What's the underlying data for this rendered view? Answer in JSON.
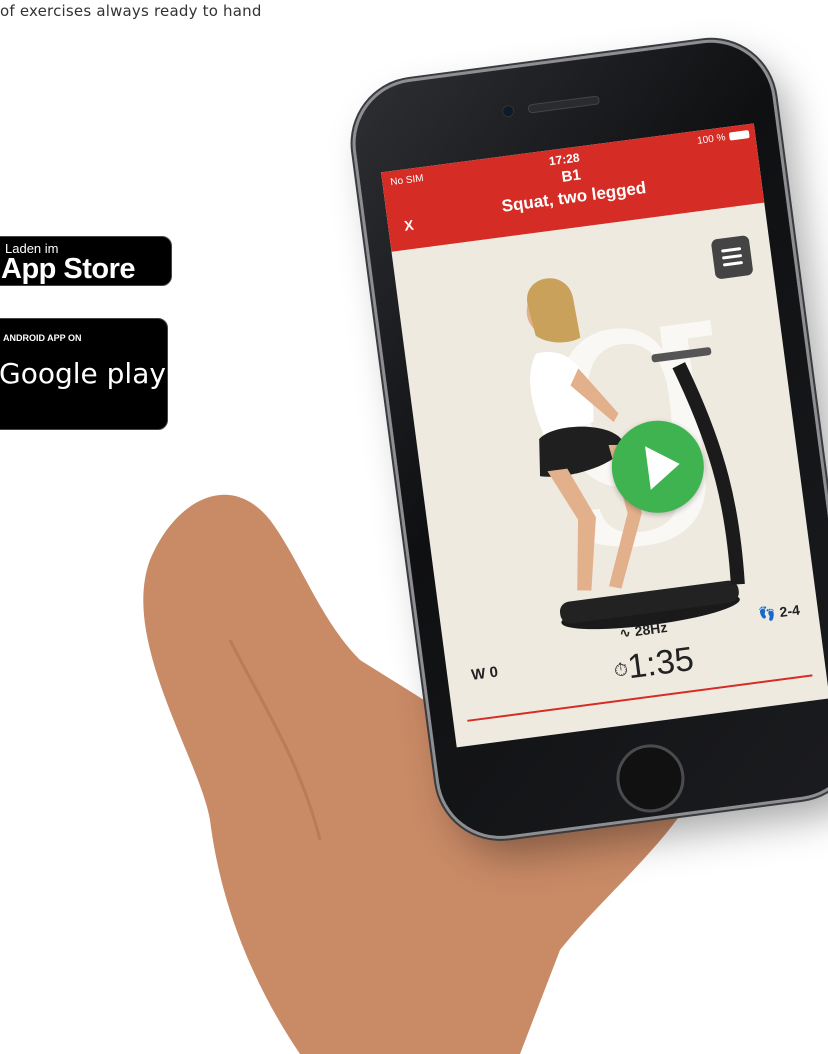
{
  "page": {
    "tagline": "of exercises always ready to hand"
  },
  "badges": {
    "appstore": {
      "line1": "Laden im",
      "line2": "App Store"
    },
    "google": {
      "line1": "ANDROID APP ON",
      "line2": "Google play"
    }
  },
  "app": {
    "status": {
      "carrier": "No SIM",
      "time": "17:28",
      "battery": "100 %"
    },
    "close_label": "X",
    "exercise_code": "B1",
    "exercise_name": "Squat, two legged",
    "menu_icon": "hamburger-menu-icon",
    "play_icon": "play-icon",
    "weight": "W 0",
    "frequency": "28Hz",
    "steps": "2-4",
    "timer": "1:35",
    "colors": {
      "header": "#d62c26",
      "play": "#3fb34f",
      "background": "#efeae0"
    }
  }
}
